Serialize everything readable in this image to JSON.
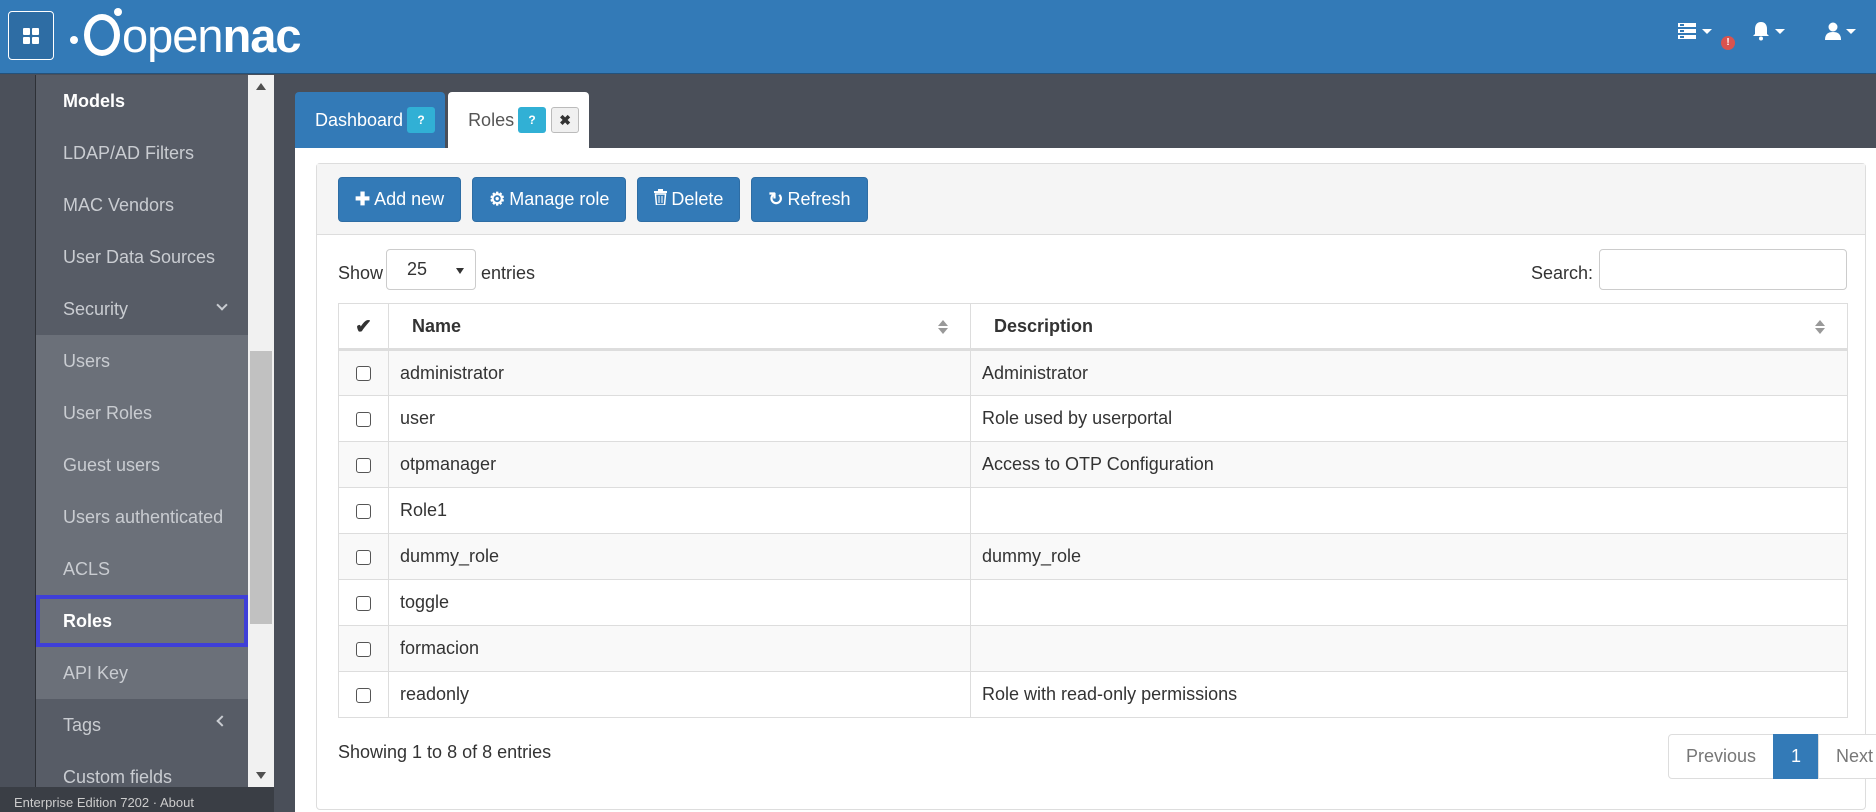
{
  "topbar": {
    "logo_prefix": "open",
    "logo_bold": "nac",
    "icons": [
      "apps-icon",
      "server-icon",
      "alert-icon",
      "bell-icon",
      "user-icon"
    ],
    "alert_badge": "!"
  },
  "sidebar": {
    "items": [
      {
        "label": "Models"
      },
      {
        "label": "LDAP/AD Filters"
      },
      {
        "label": "MAC Vendors"
      },
      {
        "label": "User Data Sources"
      },
      {
        "label": "Security"
      },
      {
        "label": "Users"
      },
      {
        "label": "User Roles"
      },
      {
        "label": "Guest users"
      },
      {
        "label": "Users authenticated"
      },
      {
        "label": "ACLS"
      },
      {
        "label": "Roles"
      },
      {
        "label": "API Key"
      },
      {
        "label": "Tags"
      },
      {
        "label": "Custom fields"
      }
    ],
    "footer": "Enterprise Edition 7202 · About"
  },
  "tabs": [
    {
      "label": "Dashboard",
      "help": "?"
    },
    {
      "label": "Roles",
      "help": "?",
      "close": "✖"
    }
  ],
  "toolbar": {
    "add_label": "Add new",
    "manage_label": "Manage role",
    "delete_label": "Delete",
    "refresh_label": "Refresh"
  },
  "controls": {
    "show_label": "Show",
    "page_size": "25",
    "entries_label": "entries",
    "search_label": "Search:",
    "search_value": ""
  },
  "table": {
    "check_header": "✔",
    "columns": [
      "Name",
      "Description"
    ],
    "rows": [
      {
        "name": "administrator",
        "description": "Administrator"
      },
      {
        "name": "user",
        "description": "Role used by userportal"
      },
      {
        "name": "otpmanager",
        "description": "Access to OTP Configuration"
      },
      {
        "name": "Role1",
        "description": ""
      },
      {
        "name": "dummy_role",
        "description": "dummy_role"
      },
      {
        "name": "toggle",
        "description": ""
      },
      {
        "name": "formacion",
        "description": ""
      },
      {
        "name": "readonly",
        "description": "Role with read-only permissions"
      }
    ]
  },
  "footer": {
    "info": "Showing 1 to 8 of 8 entries",
    "previous": "Previous",
    "current_page": "1",
    "next": "Next"
  },
  "colors": {
    "primary": "#337ab7",
    "sidebar_bg": "#575c66",
    "active_outline": "#3f3fd8",
    "alert": "#d9534f"
  }
}
